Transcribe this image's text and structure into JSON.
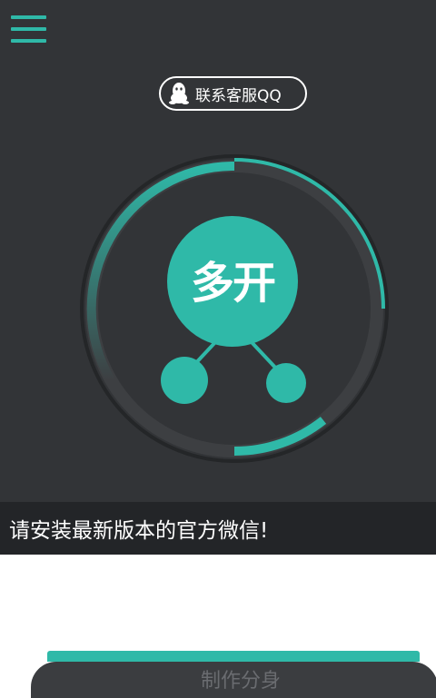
{
  "header": {
    "menu_icon": "hamburger-menu-icon",
    "support_button": {
      "label": "联系客服QQ",
      "icon": "qq-penguin-icon"
    }
  },
  "dial": {
    "label": "多开",
    "progress_segments": 2
  },
  "notice": {
    "text": "请安装最新版本的官方微信!"
  },
  "bottom_card": {
    "label": "制作分身"
  },
  "colors": {
    "background": "#323437",
    "accent": "#2fb9a8",
    "ring_track": "#3d3f42",
    "notice_bar": "#232528"
  }
}
